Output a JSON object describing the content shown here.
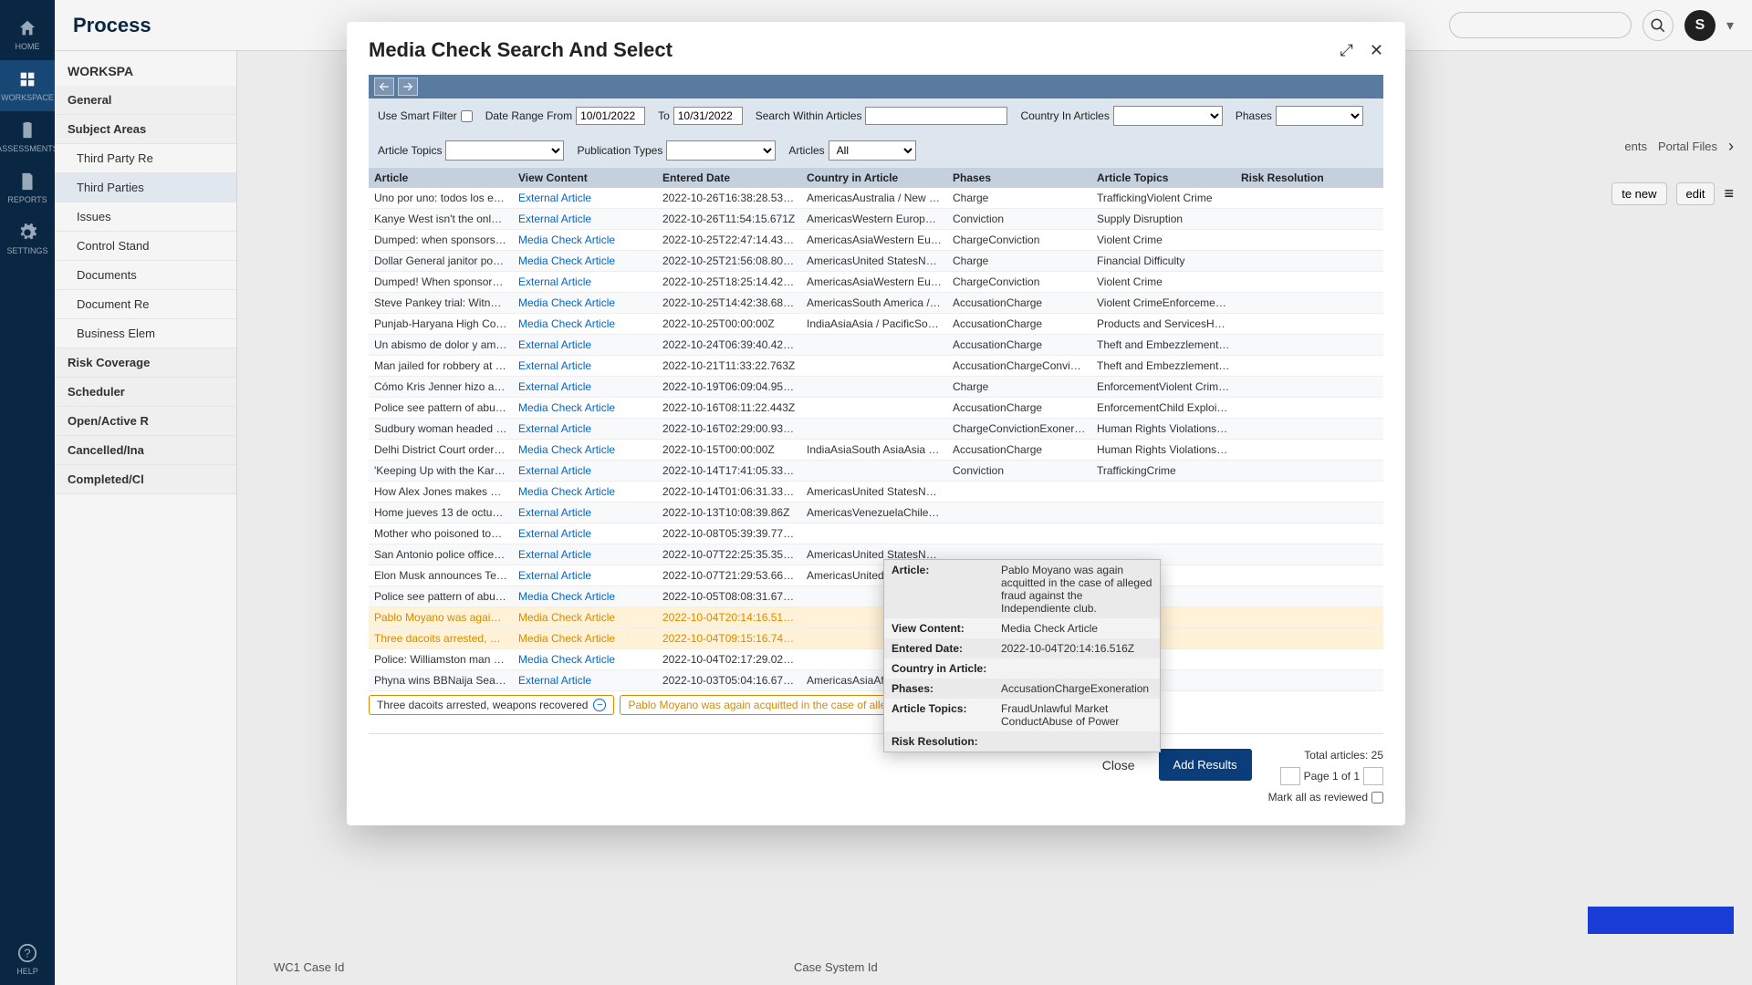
{
  "nav": {
    "items": [
      {
        "label": "HOME",
        "icon": "home"
      },
      {
        "label": "WORKSPACE",
        "icon": "grid"
      },
      {
        "label": "ASSESSMENTS",
        "icon": "clipboard"
      },
      {
        "label": "REPORTS",
        "icon": "doc"
      },
      {
        "label": "SETTINGS",
        "icon": "gear"
      }
    ],
    "help": "HELP"
  },
  "bg": {
    "logo": "Process",
    "avatar_initial": "S",
    "ws_title": "WORKSPA",
    "sidebar_items": [
      {
        "label": "General",
        "bold": true
      },
      {
        "label": "Subject Areas",
        "bold": true
      },
      {
        "label": "Third Party Re",
        "sub": true
      },
      {
        "label": "Third Parties",
        "sub": true,
        "sel": true
      },
      {
        "label": "Issues",
        "sub": true
      },
      {
        "label": "Control Stand",
        "sub": true
      },
      {
        "label": "Documents",
        "sub": true
      },
      {
        "label": "Document Re",
        "sub": true
      },
      {
        "label": "Business Elem",
        "sub": true
      },
      {
        "label": "Risk Coverage",
        "bold": true
      },
      {
        "label": "Scheduler",
        "bold": true
      },
      {
        "label": "Open/Active R",
        "bold": true
      },
      {
        "label": "Cancelled/Ina",
        "bold": true
      },
      {
        "label": "Completed/Cl",
        "bold": true
      }
    ],
    "topright_labels": [
      "ents",
      "Portal Files"
    ],
    "btn_new": "te new",
    "btn_edit": "edit",
    "bottom_left": "WC1 Case Id",
    "bottom_right": "Case System Id"
  },
  "modal": {
    "title": "Media Check Search And Select",
    "filters": {
      "smart_filter": "Use Smart Filter",
      "date_from_label": "Date Range From",
      "date_from": "10/01/2022",
      "to_label": "To",
      "date_to": "10/31/2022",
      "search_label": "Search Within Articles",
      "country_label": "Country In Articles",
      "phases_label": "Phases",
      "topics_label": "Article Topics",
      "pubtypes_label": "Publication Types",
      "articles_label": "Articles",
      "articles_value": "All"
    },
    "columns": [
      "Article",
      "View Content",
      "Entered Date",
      "Country in Article",
      "Phases",
      "Article Topics",
      "Risk Resolution"
    ],
    "rows": [
      {
        "article": "Uno por uno: todos los estrenos ...",
        "view": "External Article",
        "date": "2022-10-26T16:38:28.532Z",
        "country": "AmericasAustralia / New Zealan...",
        "phases": "Charge",
        "topics": "TraffickingViolent Crime",
        "risk": ""
      },
      {
        "article": "Kanye West isn't the only celebri...",
        "view": "External Article",
        "date": "2022-10-26T11:54:15.671Z",
        "country": "AmericasWestern EuropeEast As...",
        "phases": "Conviction",
        "topics": "Supply Disruption",
        "risk": ""
      },
      {
        "article": "Dumped: when sponsors cut tie...",
        "view": "Media Check Article",
        "date": "2022-10-25T22:47:14.433Z",
        "country": "AmericasAsiaWestern EuropeEa...",
        "phases": "ChargeConviction",
        "topics": "Violent Crime",
        "risk": ""
      },
      {
        "article": "Dollar General janitor pours ble...",
        "view": "Media Check Article",
        "date": "2022-10-25T21:56:08.802Z",
        "country": "AmericasUnited StatesNorth Am...",
        "phases": "Charge",
        "topics": "Financial Difficulty",
        "risk": ""
      },
      {
        "article": "Dumped! When sponsors cut tie...",
        "view": "External Article",
        "date": "2022-10-25T18:25:14.422Z",
        "country": "AmericasAsiaWestern EuropeEa...",
        "phases": "ChargeConviction",
        "topics": "Violent Crime",
        "risk": ""
      },
      {
        "article": "Steve Pankey trial: Witness highl...",
        "view": "Media Check Article",
        "date": "2022-10-25T14:42:38.683Z",
        "country": "AmericasSouth America / Centra...",
        "phases": "AccusationCharge",
        "topics": "Violent CrimeEnforcementChild ...",
        "risk": ""
      },
      {
        "article": "Punjab-Haryana High Court ord...",
        "view": "Media Check Article",
        "date": "2022-10-25T00:00:00Z",
        "country": "IndiaAsiaAsia / PacificSouth Asia",
        "phases": "AccusationCharge",
        "topics": "Products and ServicesHuman Ri...",
        "risk": ""
      },
      {
        "article": "Un abismo de dolor y amor: las ...",
        "view": "External Article",
        "date": "2022-10-24T06:39:40.425Z",
        "country": "",
        "phases": "AccusationCharge",
        "topics": "Theft and EmbezzlementViolent...",
        "risk": ""
      },
      {
        "article": "Man jailed for robbery at Darwe...",
        "view": "External Article",
        "date": "2022-10-21T11:33:22.763Z",
        "country": "",
        "phases": "AccusationChargeConviction",
        "topics": "Theft and EmbezzlementViolent...",
        "risk": ""
      },
      {
        "article": "Cómo Kris Jenner hizo a las Kar...",
        "view": "External Article",
        "date": "2022-10-19T06:09:04.958Z",
        "country": "",
        "phases": "Charge",
        "topics": "EnforcementViolent CrimeCrime",
        "risk": ""
      },
      {
        "article": "Police see pattern of abuse in to...",
        "view": "Media Check Article",
        "date": "2022-10-16T08:11:22.443Z",
        "country": "",
        "phases": "AccusationCharge",
        "topics": "EnforcementChild ExploitationA...",
        "risk": ""
      },
      {
        "article": "Sudbury woman headed to the ...",
        "view": "External Article",
        "date": "2022-10-16T02:29:00.932Z",
        "country": "",
        "phases": "ChargeConvictionExoneration",
        "topics": "Human Rights ViolationsTheft a...",
        "risk": ""
      },
      {
        "article": "Delhi District Court order: Kirti K...",
        "view": "Media Check Article",
        "date": "2022-10-15T00:00:00Z",
        "country": "IndiaAsiaSouth AsiaAsia / Pacific",
        "phases": "AccusationCharge",
        "topics": "Human Rights ViolationsViolent ...",
        "risk": ""
      },
      {
        "article": "'Keeping Up with the Kardashia...",
        "view": "External Article",
        "date": "2022-10-14T17:41:05.333Z",
        "country": "",
        "phases": "Conviction",
        "topics": "TraffickingCrime",
        "risk": ""
      },
      {
        "article": "How Alex Jones makes millions ...",
        "view": "Media Check Article",
        "date": "2022-10-14T01:06:31.332Z",
        "country": "AmericasUnited StatesNorth Am...",
        "phases": "",
        "topics": "",
        "risk": ""
      },
      {
        "article": "Home jueves 13 de octubre de 2...",
        "view": "External Article",
        "date": "2022-10-13T10:08:39.86Z",
        "country": "AmericasVenezuelaChileEcuado...",
        "phases": "",
        "topics": "",
        "risk": ""
      },
      {
        "article": "Mother who poisoned toddler re...",
        "view": "External Article",
        "date": "2022-10-08T05:39:39.777Z",
        "country": "",
        "phases": "",
        "topics": "",
        "risk": ""
      },
      {
        "article": "San Antonio police officer fired ...",
        "view": "External Article",
        "date": "2022-10-07T22:25:35.351Z",
        "country": "AmericasUnited StatesNorth Am...",
        "phases": "",
        "topics": "",
        "risk": ""
      },
      {
        "article": "Elon Musk announces Tesla sem...",
        "view": "External Article",
        "date": "2022-10-07T21:29:53.664Z",
        "country": "AmericasUnited StatesNorth Am...",
        "phases": "",
        "topics": "",
        "risk": ""
      },
      {
        "article": "Police see pattern of abuse in to...",
        "view": "Media Check Article",
        "date": "2022-10-05T08:08:31.675Z",
        "country": "",
        "phases": "",
        "topics": "A...",
        "risk": ""
      },
      {
        "article": "Pablo Moyano was again acquitt...",
        "view": "Media Check Article",
        "date": "2022-10-04T20:14:16.516Z",
        "country": "",
        "phases": "",
        "topics": "...",
        "risk": "",
        "selected": true
      },
      {
        "article": "Three dacoits arrested, weapon...",
        "view": "Media Check Article",
        "date": "2022-10-04T09:15:16.748Z",
        "country": "",
        "phases": "",
        "topics": "n...",
        "risk": "",
        "selected": true
      },
      {
        "article": "Police: Williamston man charge...",
        "view": "Media Check Article",
        "date": "2022-10-04T02:17:29.026Z",
        "country": "",
        "phases": "",
        "topics": "V...",
        "risk": ""
      },
      {
        "article": "Phyna wins BBNaija Season 7, N...",
        "view": "External Article",
        "date": "2022-10-03T05:04:16.675Z",
        "country": "AmericasAsiaAfricaSouth-Easter...",
        "phases": "",
        "topics": "",
        "risk": ""
      }
    ],
    "chips": [
      {
        "text": "Three dacoits arrested, weapons recovered",
        "orange": false
      },
      {
        "text": "Pablo Moyano was again acquitted in the case of alleged fraud against the Independiente club.",
        "orange": true
      }
    ],
    "footer": {
      "close": "Close",
      "add": "Add Results",
      "total": "Total articles: 25",
      "page_text": "Page 1 of 1",
      "mark": "Mark all as reviewed"
    }
  },
  "tooltip": {
    "rows": [
      {
        "label": "Article:",
        "value": "Pablo Moyano was again acquitted in the case of alleged fraud against the Independiente club."
      },
      {
        "label": "View Content:",
        "value": "Media Check Article"
      },
      {
        "label": "Entered Date:",
        "value": "2022-10-04T20:14:16.516Z"
      },
      {
        "label": "Country in Article:",
        "value": ""
      },
      {
        "label": "Phases:",
        "value": "AccusationChargeExoneration"
      },
      {
        "label": "Article Topics:",
        "value": "FraudUnlawful Market ConductAbuse of Power"
      },
      {
        "label": "Risk Resolution:",
        "value": ""
      }
    ]
  }
}
